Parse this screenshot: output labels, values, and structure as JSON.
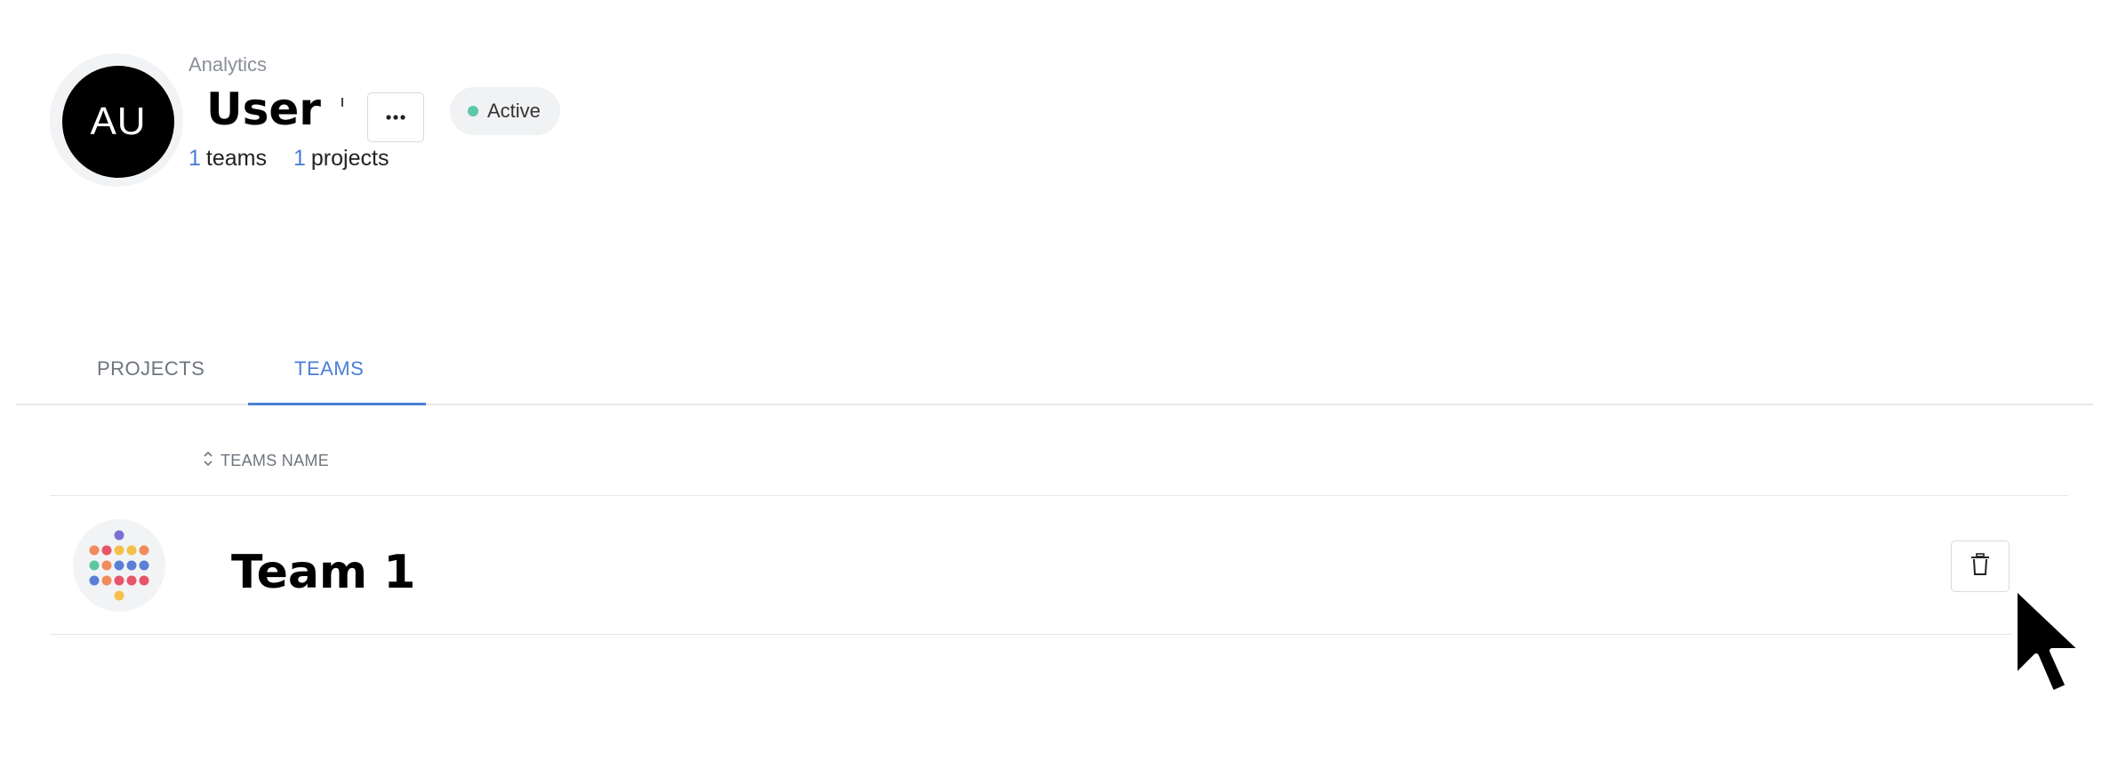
{
  "header": {
    "avatar_initials": "AU",
    "breadcrumb": "Analytics",
    "user_name": "User",
    "more_button_label": "···",
    "status": {
      "label": "Active",
      "color": "#5cc8a8"
    },
    "counts": [
      {
        "number": "1",
        "label": "teams"
      },
      {
        "number": "1",
        "label": "projects"
      }
    ]
  },
  "tabs": [
    {
      "label": "PROJECTS",
      "active": false
    },
    {
      "label": "TEAMS",
      "active": true
    }
  ],
  "table": {
    "columns": [
      {
        "label": "TEAMS NAME",
        "sortable": true
      }
    ],
    "rows": [
      {
        "name": "Team 1",
        "logo": "dot-grid-logo",
        "action_icon": "trash-icon"
      }
    ]
  },
  "colors": {
    "accent": "#4a7fd6",
    "logo_dots": [
      "#7b6fd6",
      "#f28b5a",
      "#e8546a",
      "#f5c04a",
      "#5fc7a0",
      "#5b7fd6"
    ]
  }
}
